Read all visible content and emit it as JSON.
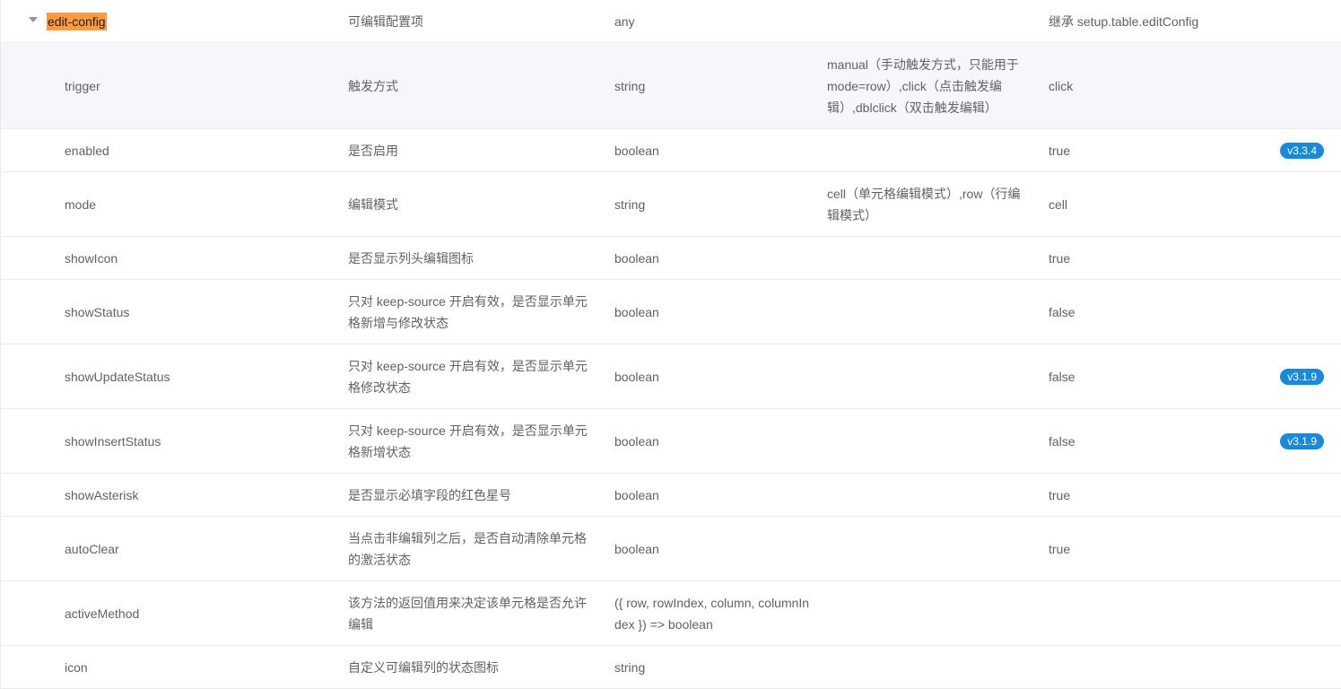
{
  "rows": [
    {
      "name": "edit-config",
      "desc": "可编辑配置项",
      "type": "any",
      "values": "",
      "default": "继承 setup.table.editConfig",
      "version": ""
    },
    {
      "name": "trigger",
      "desc": "触发方式",
      "type": "string",
      "values": "manual（手动触发方式，只能用于mode=row）,click（点击触发编辑）,dblclick（双击触发编辑）",
      "default": "click",
      "version": ""
    },
    {
      "name": "enabled",
      "desc": "是否启用",
      "type": "boolean",
      "values": "",
      "default": "true",
      "version": "v3.3.4"
    },
    {
      "name": "mode",
      "desc": "编辑模式",
      "type": "string",
      "values": "cell（单元格编辑模式）,row（行编辑模式）",
      "default": "cell",
      "version": ""
    },
    {
      "name": "showIcon",
      "desc": "是否显示列头编辑图标",
      "type": "boolean",
      "values": "",
      "default": "true",
      "version": ""
    },
    {
      "name": "showStatus",
      "desc": "只对 keep-source 开启有效，是否显示单元格新增与修改状态",
      "type": "boolean",
      "values": "",
      "default": "false",
      "version": ""
    },
    {
      "name": "showUpdateStatus",
      "desc": "只对 keep-source 开启有效，是否显示单元格修改状态",
      "type": "boolean",
      "values": "",
      "default": "false",
      "version": "v3.1.9"
    },
    {
      "name": "showInsertStatus",
      "desc": "只对 keep-source 开启有效，是否显示单元格新增状态",
      "type": "boolean",
      "values": "",
      "default": "false",
      "version": "v3.1.9"
    },
    {
      "name": "showAsterisk",
      "desc": "是否显示必填字段的红色星号",
      "type": "boolean",
      "values": "",
      "default": "true",
      "version": ""
    },
    {
      "name": "autoClear",
      "desc": "当点击非编辑列之后，是否自动清除单元格的激活状态",
      "type": "boolean",
      "values": "",
      "default": "true",
      "version": ""
    },
    {
      "name": "activeMethod",
      "desc": "该方法的返回值用来决定该单元格是否允许编辑",
      "type": "({ row, rowIndex, column, columnIndex }) => boolean",
      "values": "",
      "default": "",
      "version": ""
    },
    {
      "name": "icon",
      "desc": "自定义可编辑列的状态图标",
      "type": "string",
      "values": "",
      "default": "",
      "version": ""
    }
  ],
  "icons": {
    "expand": "caret-down-icon"
  },
  "colors": {
    "highlight": "#ff9b3e",
    "badge": "#1989d8",
    "hover_row": "#f5f7fa",
    "border": "#e8eaec"
  }
}
